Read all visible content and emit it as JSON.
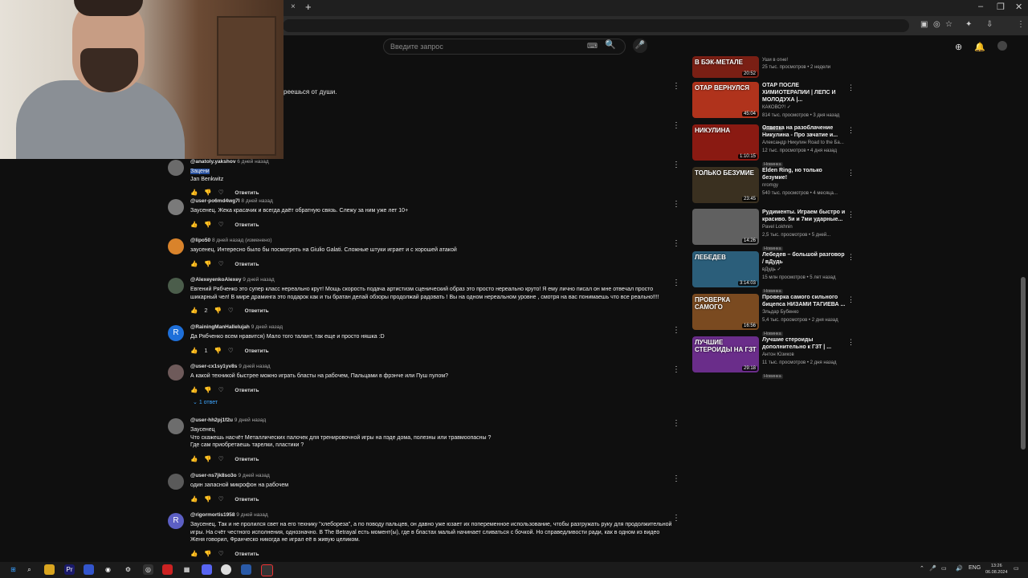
{
  "browser": {
    "tab_close": "×",
    "new_tab": "+",
    "win_min": "–",
    "win_max": "❐",
    "win_close": "✕"
  },
  "header": {
    "search_placeholder": "Введите запрос",
    "keyboard_icon": "⌨",
    "search_icon": "🔍",
    "mic_icon": "🎤",
    "create_icon": "⊕",
    "bell_icon": "🔔"
  },
  "bg_text": "реешься от души.",
  "comments": [
    {
      "author": "@anatoly.yakshov",
      "time": "6 дней назад",
      "text_hl": "Зацени",
      "text": " Jan Benkwitz",
      "likes": "",
      "avatar": "",
      "avatar_color": "#6b6b6b"
    },
    {
      "author": "@user-po6md4wg7l",
      "time": "8 дней назад",
      "text_hl": "",
      "text": "Заусенец. Жека красачик и всегда даёт обратную связь. Слежу за ним уже лет 10+",
      "likes": "",
      "avatar": "",
      "avatar_color": "#7a7a7a"
    },
    {
      "author": "@lipo50",
      "time": "8 дней назад (изменено)",
      "text_hl": "",
      "text": "заусенец. Интересно было бы посмотреть на Giulio Galati. Сложные штуки играет и с хорошей атакой",
      "likes": "",
      "avatar": "",
      "avatar_color": "#d9832b"
    },
    {
      "author": "@AlexeyenkoAlexey",
      "time": "9 дней назад",
      "text_hl": "",
      "text": "Евгений Рябченко это супер класс нереально крут!   Мощь скорость подача артистизм сценический образ это просто нереально круто! Я ему лично писал он мне отвечал просто шикарный чел! В мире драминга это подарок как и ты братан делай обзоры продолжай радовать ! Вы на одном нереальном уровне , смотря на вас понимаешь что все реально!!!!",
      "likes": "2",
      "avatar": "",
      "avatar_color": "#4b5d4b"
    },
    {
      "author": "@RainingManHallelujah",
      "time": "9 дней назад",
      "text_hl": "",
      "text": "Да Рябченко всем нравится) Мало того талант, так еще и просто няшка :D",
      "likes": "1",
      "avatar": "R",
      "avatar_color": "#1e6fd9"
    },
    {
      "author": "@user-cx1sy1yv8s",
      "time": "9 дней назад",
      "text_hl": "",
      "text": "А какой техникой быстрее можно играть бласты на рабочем, Пальцами в фрэнче или Пуш пулом?",
      "likes": "",
      "avatar": "",
      "avatar_color": "#6e5a5a"
    },
    {
      "author": "@user-hh2pj1f2u",
      "time": "9 дней назад",
      "text_hl": "",
      "text": "Заусенец\nЧто скажешь насчёт Металлических палочек для тренировочной игры на пэде дома, полезны или травмоопасны  ?\nГде сам приобретаешь тарелки, пластики ?",
      "likes": "",
      "avatar": "",
      "avatar_color": "#6d6d6d"
    },
    {
      "author": "@user-ns7jk8so3o",
      "time": "9 дней назад",
      "text_hl": "",
      "text": "один запасной микрофон на рабочем",
      "likes": "",
      "avatar": "",
      "avatar_color": "#5a5a5a"
    },
    {
      "author": "@rigormortis1958",
      "time": "9 дней назад",
      "text_hl": "",
      "text": "Заусенец. Так и не пролился свет на его технику \"хлебореза\", а по поводу пальцев, он давно уже юзает их попеременное использование, чтобы разгружать руку для продолжительной игры. На счёт честного исполнения, однозначно. В The Betrayal есть момент(ы), где в бластах малый начинает сливаться с бочкой. Но справедливости ради, как в одном из видео Женя говорил, Франческо никогда не играл её в живую целиком.",
      "likes": "",
      "avatar": "R",
      "avatar_color": "#5c5fc4"
    }
  ],
  "reply_label": "Ответить",
  "replies_toggle": "1 ответ",
  "sidebar": [
    {
      "title": "",
      "channel": "",
      "meta": "Уши в огне!\n25 тыс. просмотров • 2 недели",
      "duration": "20:52",
      "badge": "",
      "caption": "В БЭК-МЕТАЛЕ",
      "thumb": "#7a1f14"
    },
    {
      "title": "ОТАР ПОСЛЕ ХИМИОТЕРАПИИ | ЛЕПС И МОЛОДУХА |...",
      "channel": "КАКОВО?! ✓",
      "meta": "814 тыс. просмотров • 3 дня назад",
      "duration": "45:04",
      "badge": "Новинка",
      "caption": "ОТАР ВЕРНУЛСЯ",
      "thumb": "#b0331c"
    },
    {
      "title": "Ответка на разоблачение Никулина - Про зачатие и...",
      "channel": "Александр Никулин Road to the Ба...",
      "meta": "12 тыс. просмотров • 4 дня назад",
      "duration": "1:10:15",
      "badge": "Новинка",
      "caption": "НИКУЛИНА",
      "thumb": "#8a1a12"
    },
    {
      "title": "Elden Ring, но только безумие!",
      "channel": "nromgy",
      "meta": "540 тыс. просмотров • 4 месяца...",
      "duration": "23:45",
      "badge": "",
      "caption": "ТОЛЬКО БЕЗУМИЕ",
      "thumb": "#3a3020"
    },
    {
      "title": "Рудименты. Играем быстро и красиво. 5и и 7ми ударные...",
      "channel": "Pavel Lokhnin",
      "meta": "2,5 тыс. просмотров • 5 дней...",
      "duration": "14:26",
      "badge": "Новинка",
      "caption": "",
      "thumb": "#606060"
    },
    {
      "title": "Лебедев – большой разговор / вДудь",
      "channel": "вДудь ✓",
      "meta": "15 млн просмотров • 5 лет назад",
      "duration": "3:14:03",
      "badge": "Новинка",
      "caption": "ЛЕБЕДЕВ",
      "thumb": "#2b5e7a"
    },
    {
      "title": "Проверка самого сильного бицепса НИЗАМИ ТАГИЕВА ...",
      "channel": "Эльдар Бубенко",
      "meta": "5,4 тыс. просмотров • 2 дня назад",
      "duration": "16:56",
      "badge": "Новинка",
      "caption": "ПРОВЕРКА САМОГО",
      "thumb": "#7a4a20"
    },
    {
      "title": "Лучшие стероиды дополнительно к ГЗТ | ...",
      "channel": "Антон Юзиков",
      "meta": "11 тыс. просмотров • 2 дня назад",
      "duration": "29:18",
      "badge": "Новинка",
      "caption": "ЛУЧШИЕ СТЕРОИДЫ НА ГЗТ",
      "thumb": "#6a2d8a"
    }
  ],
  "taskbar": {
    "lang": "ENG",
    "time": "13:26",
    "date": "06.08.2024"
  }
}
